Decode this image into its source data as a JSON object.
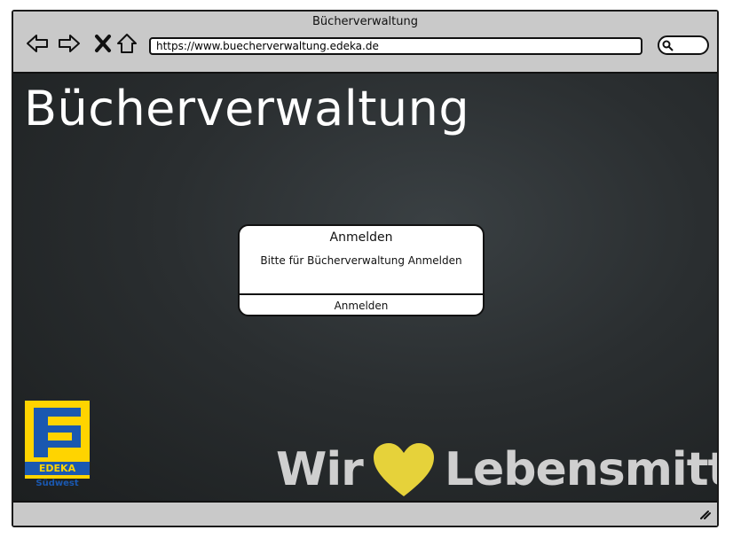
{
  "window": {
    "title": "Bücherverwaltung"
  },
  "browser": {
    "url": "https://www.buecherverwaltung.edeka.de",
    "icons": [
      "back-icon",
      "forward-icon",
      "close-icon",
      "home-icon",
      "search-icon"
    ]
  },
  "page": {
    "title": "Bücherverwaltung"
  },
  "dialog": {
    "title": "Anmelden",
    "message": "Bitte für Bücherverwaltung Anmelden",
    "button_label": "Anmelden"
  },
  "logo": {
    "band_text": "EDEKA",
    "sub_text": "Südwest"
  },
  "slogan": {
    "left": "Wir",
    "right": "Lebensmittel."
  },
  "colors": {
    "accent": "#ffd400",
    "brand_blue": "#1a58b0",
    "background": "#2a2e30"
  }
}
